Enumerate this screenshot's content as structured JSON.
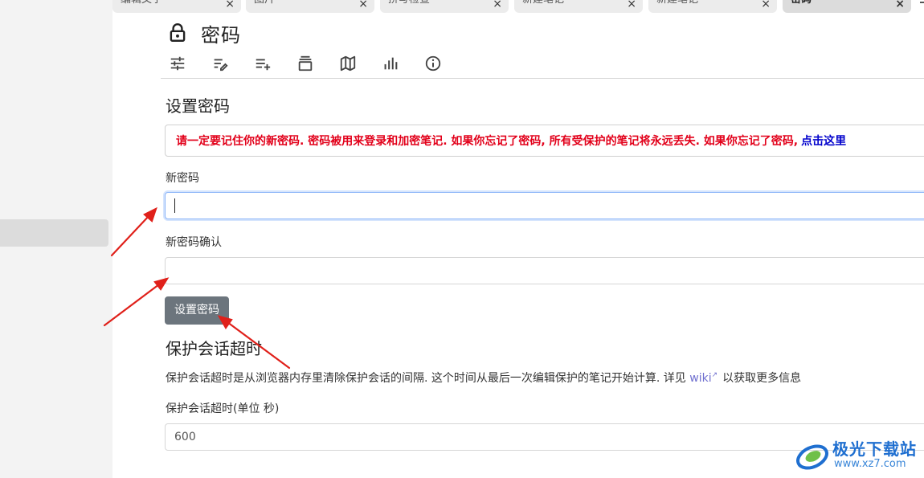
{
  "tabs": [
    {
      "title": "编辑文字",
      "close": "×"
    },
    {
      "title": "图片",
      "close": "×"
    },
    {
      "title": "拼写检查",
      "close": "×"
    },
    {
      "title": "新建笔记",
      "close": "×"
    },
    {
      "title": "新建笔记",
      "close": "×"
    },
    {
      "title": "密码",
      "close": "×",
      "active": true
    }
  ],
  "note": {
    "title": "密码",
    "title_icon": "lock-icon",
    "ribbon_icons": [
      "sliders-icon",
      "text-edit-icon",
      "add-list-icon",
      "note-stack-icon",
      "map-icon",
      "bar-chart-icon",
      "info-icon"
    ]
  },
  "set_password": {
    "heading": "设置密码",
    "alert_text": "请一定要记住你的新密码. 密码被用来登录和加密笔记. 如果你忘记了密码, 所有受保护的笔记将永远丢失. 如果你忘记了密码,",
    "alert_link": "点击这里",
    "new_password_label": "新密码",
    "new_password_value": "",
    "confirm_label": "新密码确认",
    "confirm_value": "",
    "button_label": "设置密码"
  },
  "session_timeout": {
    "heading": "保护会话超时",
    "description": "保护会话超时是从浏览器内存里清除保护会话的间隔. 这个时间从最后一次编辑保护的笔记开始计算. 详见",
    "wiki_link": "wiki",
    "description_tail": "以获取更多信息",
    "field_label": "保护会话超时(单位 秒)",
    "field_value": "600"
  },
  "watermark": {
    "name": "极光下载站",
    "url": "www.xz7.com"
  },
  "colors": {
    "alert_red": "#e2001a",
    "link_blue": "#0000cc",
    "button_gray": "#6c757d",
    "arrow_red": "#e0201a"
  }
}
